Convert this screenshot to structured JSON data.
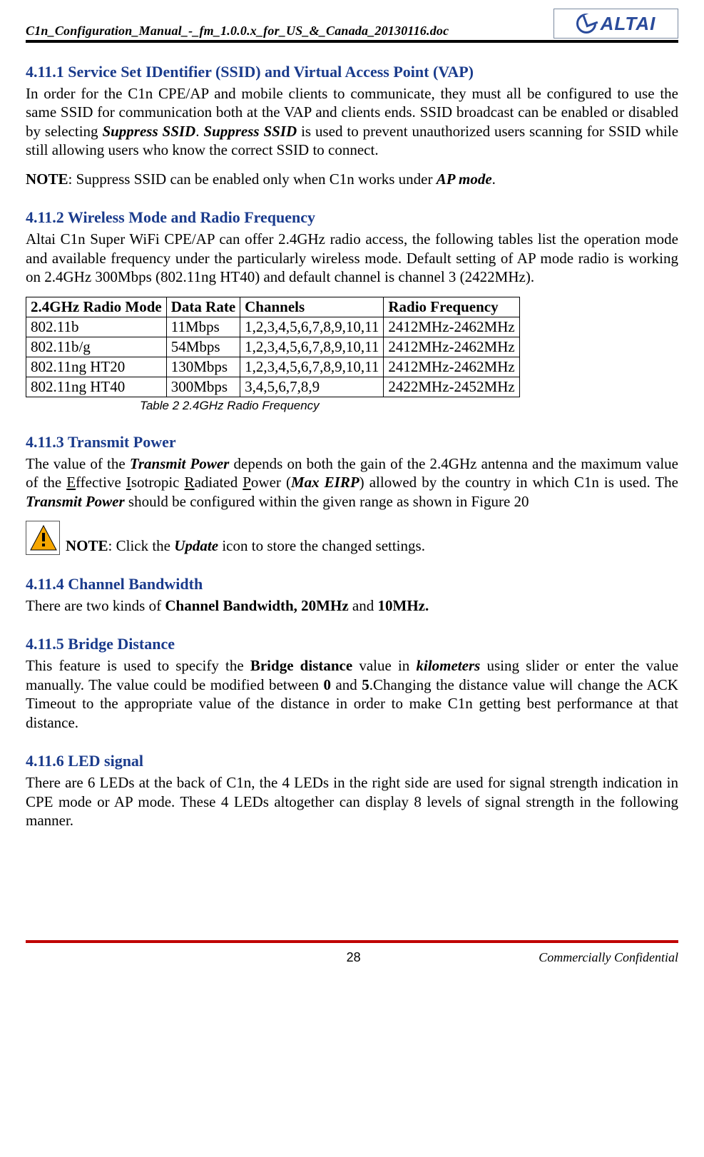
{
  "header": {
    "doc_title": "C1n_Configuration_Manual_-_fm_1.0.0.x_for_US_&_Canada_20130116.doc",
    "logo_text": "ALTAI"
  },
  "sections": {
    "s1": {
      "heading": "4.11.1  Service Set IDentifier (SSID) and Virtual Access Point (VAP)",
      "p1a": "In order for the C1n CPE/AP and mobile clients to communicate, they must all be configured to use the same SSID for communication both at the VAP and clients ends. SSID broadcast can be enabled or disabled by selecting ",
      "p1b": "Suppress SSID",
      "p1c": ". ",
      "p1d": "Suppress SSID",
      "p1e": " is used to prevent unauthorized users scanning for SSID while still allowing users who know the correct SSID to connect.",
      "note_label": "NOTE",
      "note_text": ": Suppress SSID can be enabled only when C1n works under ",
      "note_mode": "AP mode",
      "note_end": "."
    },
    "s2": {
      "heading": "4.11.2  Wireless Mode and Radio Frequency",
      "p1": "Altai C1n Super WiFi CPE/AP can offer 2.4GHz radio access, the following tables list the operation mode and available frequency under the particularly wireless mode. Default setting of AP mode radio is working on 2.4GHz 300Mbps (802.11ng HT40) and default channel is channel 3 (2422MHz).",
      "table": {
        "headers": [
          "2.4GHz Radio Mode",
          "Data Rate",
          "Channels",
          "Radio Frequency"
        ],
        "rows": [
          [
            "802.11b",
            "11Mbps",
            "1,2,3,4,5,6,7,8,9,10,11",
            "2412MHz-2462MHz"
          ],
          [
            "802.11b/g",
            "54Mbps",
            "1,2,3,4,5,6,7,8,9,10,11",
            "2412MHz-2462MHz"
          ],
          [
            "802.11ng HT20",
            "130Mbps",
            "1,2,3,4,5,6,7,8,9,10,11",
            "2412MHz-2462MHz"
          ],
          [
            "802.11ng HT40",
            "300Mbps",
            "3,4,5,6,7,8,9",
            "2422MHz-2452MHz"
          ]
        ],
        "caption": "Table 2    2.4GHz Radio Frequency"
      }
    },
    "s3": {
      "heading": "4.11.3  Transmit Power",
      "p1a": "The value of the ",
      "p1b": "Transmit Power",
      "p1c": " depends on both the gain of the 2.4GHz antenna and the maximum value of the ",
      "eirp_e": "E",
      "eirp_t1": "ffective ",
      "eirp_i": "I",
      "eirp_t2": "sotropic ",
      "eirp_r": "R",
      "eirp_t3": "adiated ",
      "eirp_p": "P",
      "eirp_t4": "ower (",
      "eirp_max": "Max EIRP",
      "p1d": ") allowed by the country in which C1n is used. The ",
      "p1e": "Transmit Power",
      "p1f": " should be configured within the given range as shown in Figure 20",
      "note_label": "NOTE",
      "note_a": ": Click the ",
      "note_b": "Update",
      "note_c": " icon to store the changed settings."
    },
    "s4": {
      "heading": "4.11.4  Channel Bandwidth",
      "p1a": "There are two kinds of ",
      "p1b": "Channel Bandwidth, 20MHz",
      "p1c": " and ",
      "p1d": "10MHz."
    },
    "s5": {
      "heading": "4.11.5  Bridge Distance",
      "p1a": "This feature is used to specify the ",
      "p1b": "Bridge distance",
      "p1c": " value in ",
      "p1d": "kilometers",
      "p1e": " using slider or enter the value manually. The value could be modified between ",
      "p1f": "0",
      "p1g": " and ",
      "p1h": "5",
      "p1i": ".Changing the distance value will change the ACK Timeout to the appropriate value of the distance in order to make C1n getting best performance at that distance."
    },
    "s6": {
      "heading": "4.11.6  LED signal",
      "p1": "There are 6 LEDs at the back of C1n, the 4 LEDs in the right side are used for signal strength indication in CPE mode or AP mode. These 4 LEDs altogether can display 8 levels of signal strength in the following manner."
    }
  },
  "footer": {
    "page": "28",
    "confidential": "Commercially Confidential"
  }
}
